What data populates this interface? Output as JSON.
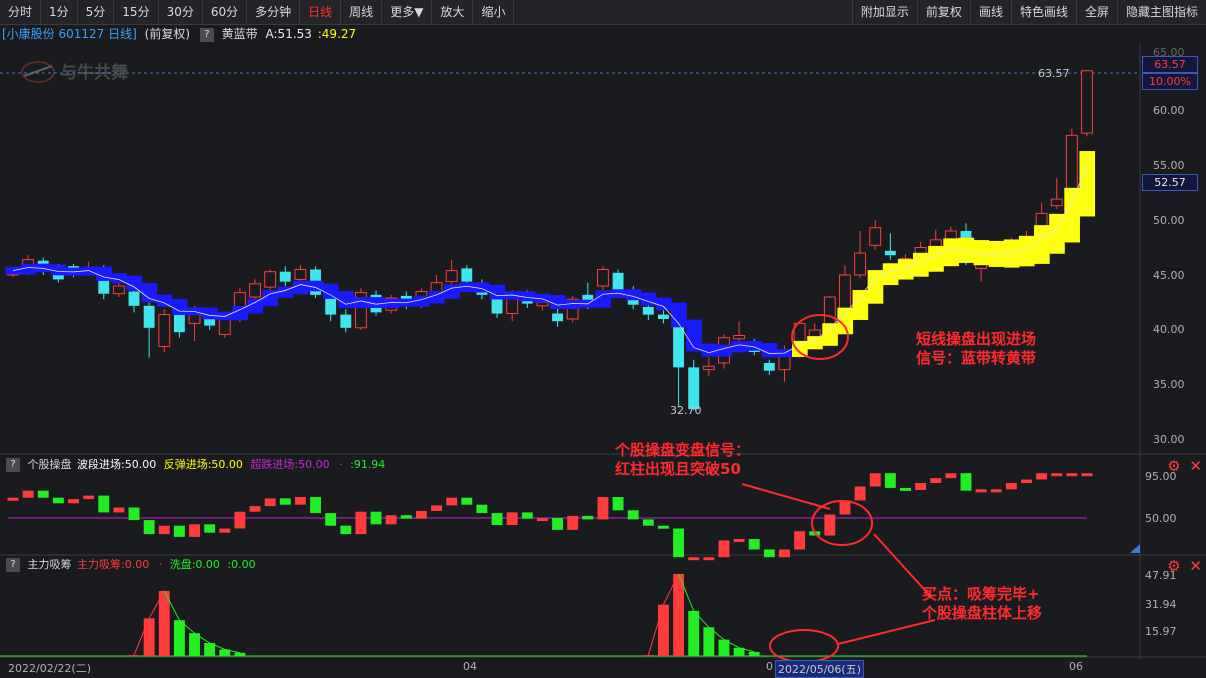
{
  "toolbar": {
    "left": [
      "分时",
      "1分",
      "5分",
      "15分",
      "30分",
      "60分",
      "多分钟",
      "日线",
      "周线",
      "更多▼",
      "放大",
      "缩小"
    ],
    "active": "日线",
    "right": [
      "附加显示",
      "前复权",
      "画线",
      "特色画线",
      "全屏",
      "隐藏主图指标"
    ]
  },
  "info": {
    "stock": "[小康股份 601127 日线]",
    "adjust": "(前复权)",
    "help": "?",
    "indicator_name": "黄蓝带",
    "a_label": "A:51.53",
    "b_value": ":49.27"
  },
  "watermark": "与牛共舞",
  "main_axis": {
    "labels": [
      "60.00",
      "55.00",
      "50.00",
      "45.00",
      "40.00",
      "35.00",
      "30.00"
    ],
    "top_partial": "65.00",
    "price_tag": "63.57",
    "pct_tag": "10.00%",
    "mid_tag": "52.57",
    "high_label": "63.57",
    "low_label": "32.70"
  },
  "panel2": {
    "help": "?",
    "name": "个股操盘",
    "f1": "波段进场:50.00",
    "f2": "反弹进场:50.00",
    "f3": "超跌进场:50.00",
    "f4": "·",
    "f5": ":91.94",
    "axis": [
      "95.00",
      "50.00"
    ]
  },
  "panel3": {
    "help": "?",
    "name": "主力吸筹",
    "f1": "主力吸筹:0.00",
    "f2": "·",
    "f3": "洗盘:0.00",
    "f4": ":0.00",
    "axis": [
      "47.91",
      "31.94",
      "15.97"
    ]
  },
  "xaxis": {
    "left_date": "2022/02/22(二)",
    "t1": "04",
    "t2": "0",
    "cursor_date": "2022/05/06(五)",
    "t3": "06"
  },
  "annotations": {
    "a1_l1": "短线操盘出现进场",
    "a1_l2": "信号：蓝带转黄带",
    "a2_l1": "个股操盘变盘信号：",
    "a2_l2": "红柱出现且突破50",
    "a3_l1": "买点：吸筹完毕+",
    "a3_l2": "个股操盘柱体上移"
  },
  "colors": {
    "up": "#ff3b3b",
    "down": "#3fe6ee",
    "blue_band": "#1a1aff",
    "yellow_band": "#ffff10",
    "green": "#22ee22",
    "purple": "#c026d3",
    "red_anno": "#ff2b2b"
  },
  "icons": {
    "settings": "gear-icon",
    "close": "close-icon"
  },
  "chart_data": {
    "type": "candlestick",
    "ylim": [
      30,
      65
    ],
    "high": 63.57,
    "low": 32.7,
    "candles": [
      [
        45.0,
        45.4,
        44.8,
        45.6
      ],
      [
        45.3,
        46.4,
        45.0,
        46.8
      ],
      [
        46.3,
        45.4,
        45.0,
        46.6
      ],
      [
        45.4,
        44.6,
        44.3,
        46.0
      ],
      [
        45.8,
        45.2,
        44.8,
        46.0
      ],
      [
        45.4,
        45.7,
        45.0,
        46.2
      ],
      [
        45.7,
        43.3,
        42.8,
        45.9
      ],
      [
        43.3,
        44.0,
        43.0,
        44.6
      ],
      [
        43.5,
        42.2,
        41.6,
        43.9
      ],
      [
        42.2,
        40.2,
        37.5,
        42.5
      ],
      [
        38.5,
        41.4,
        38.0,
        41.9
      ],
      [
        41.8,
        39.8,
        39.3,
        42.1
      ],
      [
        40.6,
        41.6,
        39.0,
        42.2
      ],
      [
        41.6,
        40.4,
        40.0,
        42.0
      ],
      [
        39.6,
        41.0,
        39.3,
        41.6
      ],
      [
        41.0,
        43.4,
        40.7,
        43.8
      ],
      [
        43.0,
        44.2,
        42.6,
        44.6
      ],
      [
        43.9,
        45.3,
        43.5,
        45.5
      ],
      [
        45.3,
        44.4,
        44.0,
        45.8
      ],
      [
        44.6,
        45.5,
        44.3,
        45.9
      ],
      [
        45.5,
        43.2,
        42.9,
        45.8
      ],
      [
        43.2,
        41.4,
        40.8,
        43.5
      ],
      [
        41.4,
        40.2,
        39.8,
        41.9
      ],
      [
        40.2,
        43.4,
        40.0,
        43.8
      ],
      [
        43.2,
        41.6,
        41.3,
        43.6
      ],
      [
        41.8,
        42.9,
        41.5,
        43.2
      ],
      [
        43.1,
        42.4,
        41.9,
        43.5
      ],
      [
        42.4,
        43.5,
        42.0,
        43.8
      ],
      [
        43.5,
        44.3,
        43.0,
        45.0
      ],
      [
        44.4,
        45.4,
        44.0,
        46.4
      ],
      [
        45.6,
        44.4,
        44.0,
        45.9
      ],
      [
        44.3,
        43.2,
        42.8,
        44.6
      ],
      [
        43.5,
        41.5,
        41.1,
        43.8
      ],
      [
        41.5,
        43.3,
        40.8,
        43.6
      ],
      [
        43.2,
        42.4,
        42.0,
        43.6
      ],
      [
        42.2,
        42.5,
        41.8,
        42.8
      ],
      [
        41.5,
        40.8,
        40.3,
        42.0
      ],
      [
        41.0,
        42.8,
        40.7,
        43.1
      ],
      [
        43.2,
        42.3,
        41.9,
        44.3
      ],
      [
        44.0,
        45.5,
        43.6,
        45.8
      ],
      [
        45.2,
        43.6,
        43.3,
        45.5
      ],
      [
        43.6,
        42.3,
        41.9,
        44.0
      ],
      [
        42.1,
        41.4,
        40.9,
        42.4
      ],
      [
        41.4,
        41.0,
        40.6,
        41.9
      ],
      [
        40.8,
        36.6,
        33.0,
        41.0
      ],
      [
        36.6,
        32.8,
        32.7,
        37.3
      ],
      [
        36.4,
        36.7,
        35.8,
        37.5
      ],
      [
        37.0,
        39.3,
        36.5,
        39.6
      ],
      [
        39.2,
        39.5,
        38.8,
        40.8
      ],
      [
        38.6,
        38.0,
        37.7,
        39.2
      ],
      [
        37.0,
        36.3,
        35.9,
        37.3
      ],
      [
        36.4,
        38.0,
        35.3,
        38.6
      ],
      [
        38.0,
        40.6,
        37.5,
        40.8
      ],
      [
        38.7,
        40.0,
        38.4,
        40.6
      ],
      [
        40.2,
        43.0,
        40.0,
        43.1
      ],
      [
        41.7,
        45.0,
        41.5,
        45.9
      ],
      [
        45.0,
        47.0,
        44.7,
        49.0
      ],
      [
        47.7,
        49.3,
        47.3,
        50.0
      ],
      [
        47.2,
        46.8,
        46.4,
        48.8
      ],
      [
        46.3,
        46.5,
        45.9,
        46.9
      ],
      [
        46.8,
        47.5,
        46.4,
        48.0
      ],
      [
        47.4,
        48.2,
        47.0,
        49.1
      ],
      [
        47.7,
        49.0,
        47.2,
        49.4
      ],
      [
        49.0,
        46.4,
        45.9,
        49.7
      ],
      [
        45.6,
        46.6,
        44.4,
        47.0
      ],
      [
        46.6,
        46.6,
        46.2,
        47.8
      ],
      [
        47.0,
        47.5,
        46.6,
        48.4
      ],
      [
        47.4,
        48.0,
        47.0,
        49.0
      ],
      [
        48.3,
        50.6,
        48.0,
        51.6
      ],
      [
        51.3,
        51.9,
        51.0,
        53.8
      ],
      [
        52.0,
        57.7,
        51.8,
        58.3
      ],
      [
        57.9,
        63.57,
        57.6,
        63.57
      ]
    ]
  }
}
